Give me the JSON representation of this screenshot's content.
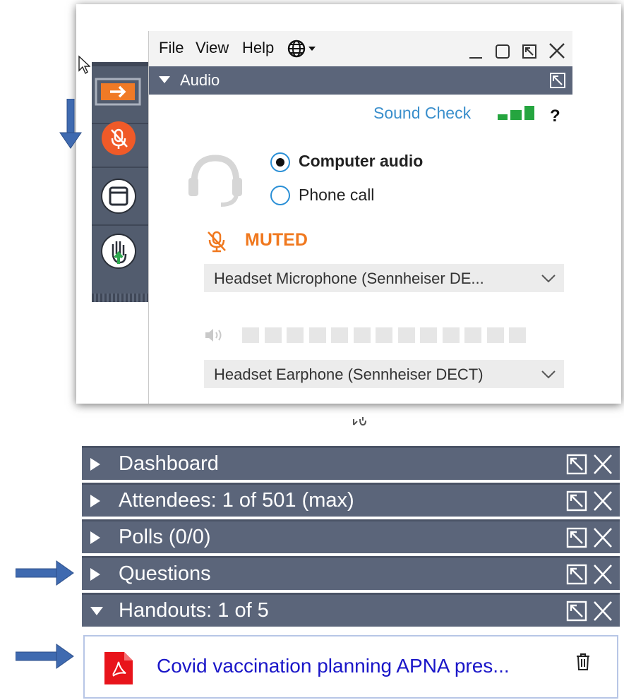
{
  "menu": {
    "file": "File",
    "view": "View",
    "help": "Help"
  },
  "audio": {
    "header": "Audio",
    "sound_check": "Sound Check",
    "help": "?",
    "computer_audio": "Computer audio",
    "phone_call": "Phone call",
    "selected_mode": "Computer audio",
    "mute_status": "MUTED",
    "microphone": "Headset  Microphone  (Sennheiser  DE...",
    "speaker": "Headset Earphone (Sennheiser DECT)",
    "speaker_level": 0
  },
  "panels": [
    {
      "title": "Dashboard",
      "expanded": false
    },
    {
      "title": "Attendees:  1 of 501 (max)",
      "expanded": false
    },
    {
      "title": "Polls (0/0)",
      "expanded": false
    },
    {
      "title": "Questions",
      "expanded": false
    },
    {
      "title": "Handouts: 1 of 5",
      "expanded": true
    }
  ],
  "handout": {
    "name": "Covid vaccination planning APNA pres..."
  },
  "colors": {
    "panel_bar": "#5b657a",
    "rail": "#525c6e",
    "accent_orange": "#f0781e",
    "link_blue": "#3a8fcc",
    "handout_blue": "#1a16c8",
    "annotation_arrow": "#3f6ab0"
  },
  "icons": [
    "cursor-icon",
    "exit-arrow-icon",
    "mic-muted-icon",
    "window-icon",
    "raise-hand-icon",
    "globe-icon",
    "minimize-icon",
    "maximize-icon",
    "popout-icon",
    "close-icon",
    "headset-icon",
    "signal-bars-icon",
    "speaker-icon",
    "chevron-down-icon",
    "pdf-icon",
    "trash-icon"
  ]
}
